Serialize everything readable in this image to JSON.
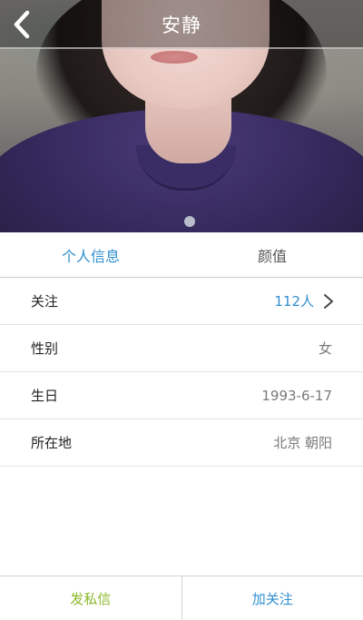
{
  "header": {
    "title": "安静",
    "back_icon": "chevron-left-icon"
  },
  "tabs": [
    {
      "label": "个人信息",
      "active": true
    },
    {
      "label": "颜值",
      "active": false
    }
  ],
  "profile": {
    "rows": [
      {
        "label": "关注",
        "value": "112人",
        "icon": "chevron-right-icon"
      },
      {
        "label": "性别",
        "value": "女"
      },
      {
        "label": "生日",
        "value": "1993-6-17"
      },
      {
        "label": "所在地",
        "value": "北京 朝阳"
      }
    ]
  },
  "actions": {
    "send_message": "发私信",
    "follow": "加关注"
  },
  "colors": {
    "accent_blue": "#2f8fd0",
    "accent_green": "#8bb82a"
  }
}
